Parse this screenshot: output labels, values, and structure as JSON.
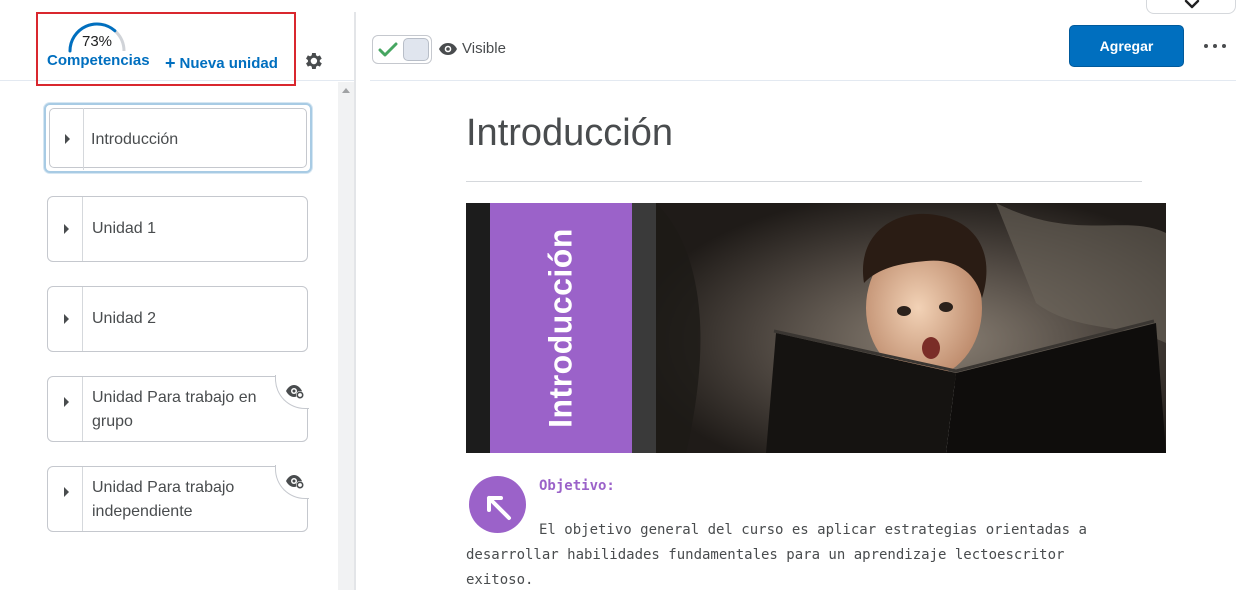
{
  "sidebar": {
    "progress": {
      "percent_label": "73%",
      "value": 0.73
    },
    "competencias_label": "Competencias",
    "new_unit_label": "Nueva unidad",
    "units": [
      {
        "label": "Introducción",
        "selected": true,
        "hidden": false
      },
      {
        "label": "Unidad 1",
        "selected": false,
        "hidden": false
      },
      {
        "label": "Unidad 2",
        "selected": false,
        "hidden": false
      },
      {
        "label": "Unidad Para trabajo en grupo",
        "selected": false,
        "hidden": true
      },
      {
        "label": "Unidad Para trabajo independiente",
        "selected": false,
        "hidden": true
      }
    ]
  },
  "toolbar": {
    "visibility_label": "Visible",
    "add_label": "Agregar"
  },
  "content": {
    "title": "Introducción",
    "banner_text": "Introducción",
    "objective_label": "Objetivo:",
    "objective_text": "El objetivo general del curso es aplicar estrategias orientadas a desarrollar habilidades fundamentales para un aprendizaje lectoescritor exitoso."
  },
  "colors": {
    "accent": "#006fbf",
    "highlight_box": "#d9272e",
    "banner_purple": "#9b62c9",
    "check_green": "#46a661"
  },
  "icons": {
    "settings": "gear-icon",
    "visibility": "eye-icon",
    "hidden": "eye-hidden-icon",
    "expand": "caret-right-icon",
    "more": "more-icon",
    "dropdown": "chevron-down-icon"
  }
}
